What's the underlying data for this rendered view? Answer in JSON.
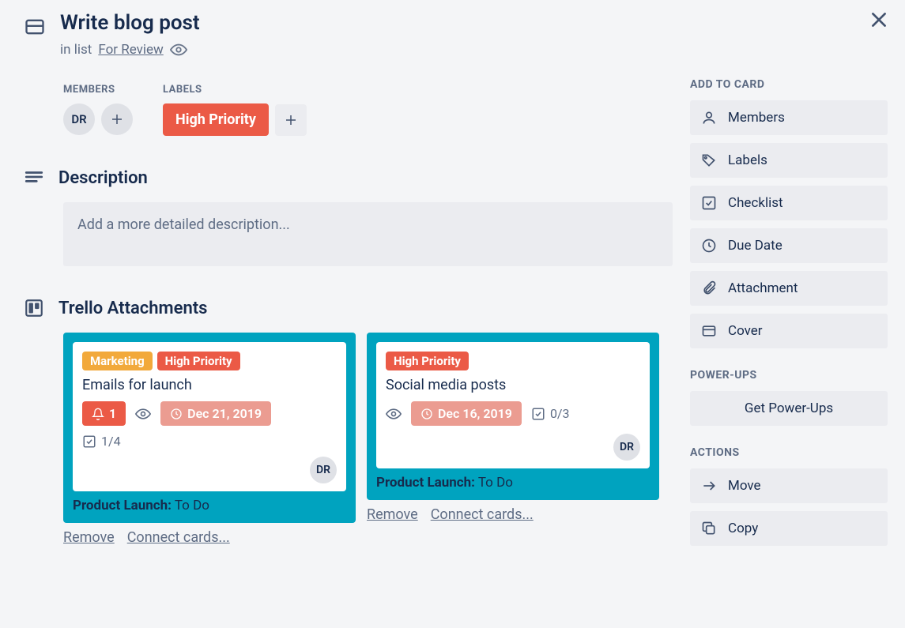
{
  "card": {
    "title": "Write blog post",
    "in_list_prefix": "in list",
    "list": "For Review"
  },
  "meta": {
    "members_label": "MEMBERS",
    "labels_label": "LABELS",
    "member_initials": "DR",
    "label_text": "High Priority"
  },
  "description": {
    "heading": "Description",
    "placeholder": "Add a more detailed description..."
  },
  "attachments_section": {
    "heading": "Trello Attachments"
  },
  "attachments": [
    {
      "labels": [
        {
          "text": "Marketing",
          "cls": "yellow"
        },
        {
          "text": "High Priority",
          "cls": "red"
        }
      ],
      "title": "Emails for launch",
      "bell_count": "1",
      "has_bell": true,
      "due": "Dec 21, 2019",
      "check": "1/4",
      "avatar": "DR",
      "board_name": "Product Launch:",
      "board_list": "To Do",
      "remove": "Remove",
      "connect": "Connect cards..."
    },
    {
      "labels": [
        {
          "text": "High Priority",
          "cls": "red"
        }
      ],
      "title": "Social media posts",
      "bell_count": "",
      "has_bell": false,
      "due": "Dec 16, 2019",
      "check": "0/3",
      "avatar": "DR",
      "board_name": "Product Launch:",
      "board_list": "To Do",
      "remove": "Remove",
      "connect": "Connect cards..."
    }
  ],
  "sidebar": {
    "add_to_card": "ADD TO CARD",
    "add_buttons": {
      "members": "Members",
      "labels": "Labels",
      "checklist": "Checklist",
      "due_date": "Due Date",
      "attachment": "Attachment",
      "cover": "Cover"
    },
    "powerups_heading": "POWER-UPS",
    "powerups_btn": "Get Power-Ups",
    "actions_heading": "ACTIONS",
    "actions": {
      "move": "Move",
      "copy": "Copy"
    }
  }
}
